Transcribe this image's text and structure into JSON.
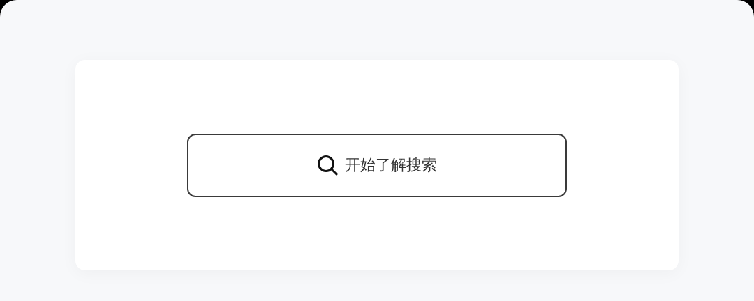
{
  "search_button": {
    "label": "开始了解搜索"
  }
}
